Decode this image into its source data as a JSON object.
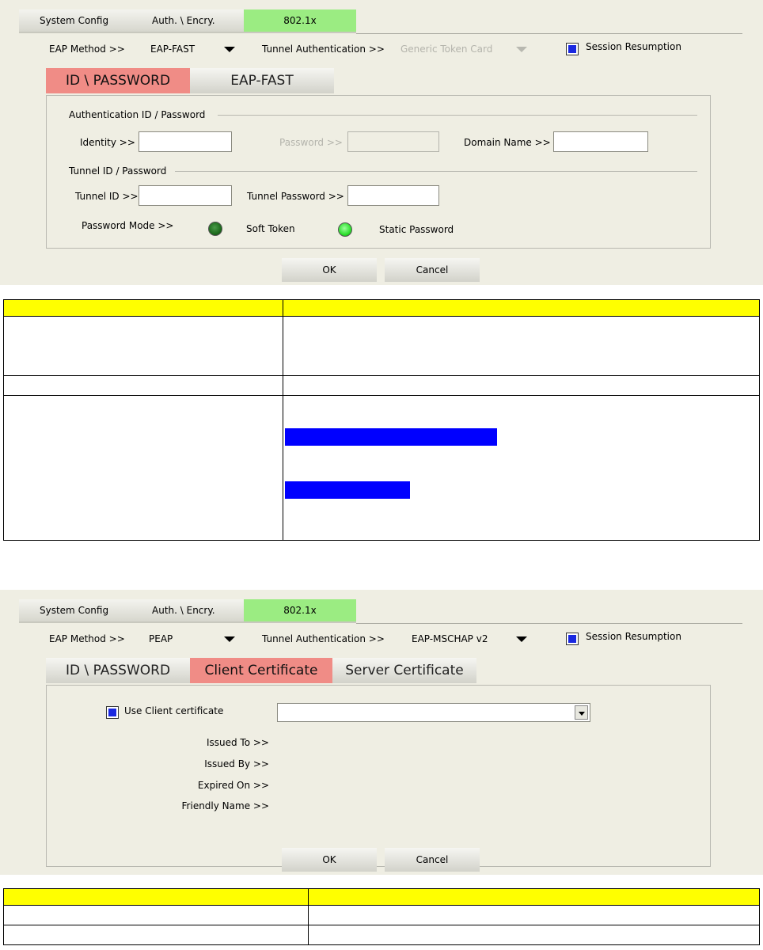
{
  "panel1": {
    "top_tabs": [
      "System Config",
      "Auth. \\ Encry.",
      "802.1x"
    ],
    "eap_method_label": "EAP Method >>",
    "eap_method_value": "EAP-FAST",
    "tunnel_auth_label": "Tunnel Authentication >>",
    "tunnel_auth_value": "Generic Token Card",
    "session_resumption": "Session Resumption",
    "sub_tabs": [
      "ID \\ PASSWORD",
      "EAP-FAST"
    ],
    "auth_section": "Authentication ID / Password",
    "identity_label": "Identity >>",
    "password_label": "Password >>",
    "domain_label": "Domain Name >>",
    "tunnel_section": "Tunnel ID / Password",
    "tunnel_id_label": "Tunnel ID >>",
    "tunnel_password_label": "Tunnel Password >>",
    "password_mode_label": "Password Mode >>",
    "soft_token": "Soft Token",
    "static_password": "Static Password",
    "ok": "OK",
    "cancel": "Cancel"
  },
  "panel2": {
    "top_tabs": [
      "System Config",
      "Auth. \\ Encry.",
      "802.1x"
    ],
    "eap_method_label": "EAP Method >>",
    "eap_method_value": "PEAP",
    "tunnel_auth_label": "Tunnel Authentication >>",
    "tunnel_auth_value": "EAP-MSCHAP v2",
    "session_resumption": "Session Resumption",
    "sub_tabs": [
      "ID \\ PASSWORD",
      "Client Certificate",
      "Server Certificate"
    ],
    "use_client_cert": "Use Client certificate",
    "issued_to": "Issued To >>",
    "issued_by": "Issued By >>",
    "expired_on": "Expired On >>",
    "friendly_name": "Friendly Name >>",
    "ok": "OK",
    "cancel": "Cancel"
  },
  "colors": {
    "panel_bg": "#efeee3",
    "active_top_tab": "#9bec82",
    "active_sub_tab": "#f08c86",
    "table_header": "#ffff00",
    "highlight": "#0000ff"
  }
}
